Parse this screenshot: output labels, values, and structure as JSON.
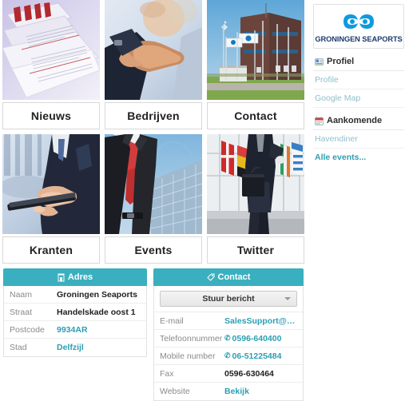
{
  "tiles": [
    {
      "label": "Nieuws",
      "image": "newspapers-photo",
      "icon": "newspaper-image"
    },
    {
      "label": "Bedrijven",
      "image": "handshake-photo",
      "icon": "handshake-image"
    },
    {
      "label": "Contact",
      "image": "office-building-photo",
      "icon": "building-image"
    },
    {
      "label": "Kranten",
      "image": "tablet-hands-photo",
      "icon": "tablet-image"
    },
    {
      "label": "Events",
      "image": "suit-redtie-photo",
      "icon": "suit-image"
    },
    {
      "label": "Twitter",
      "image": "flags-businessman-photo",
      "icon": "flags-image"
    }
  ],
  "adres": {
    "title": "Adres",
    "icon": "building-icon",
    "rows": [
      {
        "key": "Naam",
        "value": "Groningen Seaports",
        "link": false
      },
      {
        "key": "Straat",
        "value": "Handelskade oost 1",
        "link": false
      },
      {
        "key": "Postcode",
        "value": "9934AR",
        "link": true
      },
      {
        "key": "Stad",
        "value": "Delfzijl",
        "link": true
      }
    ]
  },
  "contact": {
    "title": "Contact",
    "icon": "tag-icon",
    "send_message_button": "Stuur bericht",
    "rows": [
      {
        "key": "E-mail",
        "value": "SalesSupport@gr...",
        "link": true,
        "phone": false
      },
      {
        "key": "Telefoonnummer",
        "value": "0596-640400",
        "link": true,
        "phone": true
      },
      {
        "key": "Mobile number",
        "value": "06-51225484",
        "link": true,
        "phone": true
      },
      {
        "key": "Fax",
        "value": "0596-630464",
        "link": false,
        "phone": false
      },
      {
        "key": "Website",
        "value": "Bekijk",
        "link": true,
        "phone": false
      }
    ]
  },
  "sidebar": {
    "logo": {
      "name": "GRONINGEN SEAPORTS",
      "icon": "groningen-seaports-logo"
    },
    "sections": [
      {
        "heading": "Profiel",
        "heading_icon": "profile-card-icon",
        "links": [
          {
            "label": "Profile",
            "style": "muted"
          },
          {
            "label": "Google Map",
            "style": "muted"
          }
        ]
      },
      {
        "heading": "Aankomende",
        "heading_icon": "calendar-icon",
        "links": [
          {
            "label": "Havendiner",
            "style": "muted"
          },
          {
            "label": "Alle events...",
            "style": "strong"
          }
        ]
      }
    ]
  },
  "colors": {
    "accent_teal": "#3aafbf",
    "link_teal": "#2b9fb3",
    "logo_blue": "#0f9ade",
    "logo_navy": "#1a3b6e"
  }
}
